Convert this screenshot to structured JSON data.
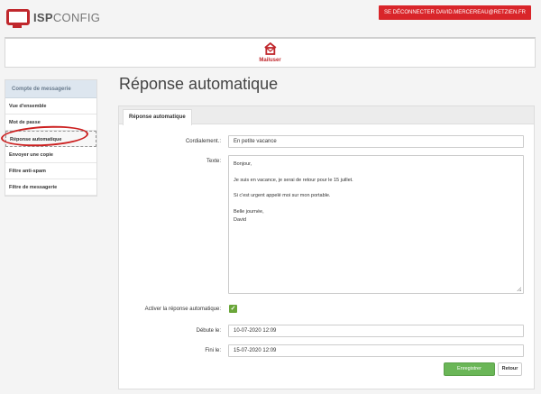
{
  "header": {
    "logo_main": "ISP",
    "logo_thin": "CONFIG",
    "logout_label": "SE DÉCONNECTER DAVID.MERCEREAU@RETZIEN.FR"
  },
  "module": {
    "label": "Mailuser",
    "icon": "mail-home-icon"
  },
  "sidebar": {
    "title": "Compte de messagerie",
    "items": [
      {
        "label": "Vue d'ensemble"
      },
      {
        "label": "Mot de passe"
      },
      {
        "label": "Réponse automatique"
      },
      {
        "label": "Envoyer une copie"
      },
      {
        "label": "Filtre anti-spam"
      },
      {
        "label": "Filtre de messagerie"
      }
    ]
  },
  "page": {
    "title": "Réponse automatique"
  },
  "tabs": [
    {
      "label": "Réponse automatique"
    }
  ],
  "form": {
    "subject": {
      "label": "Cordialement.:",
      "value": "En petite vacance"
    },
    "text": {
      "label": "Texte:",
      "lines": [
        "Bonjour,",
        "",
        "Je suis en vacance, je serai de retour pour le 15 juillet.",
        "",
        "Si c'est urgent appelé moi sur mon portable.",
        "",
        "Belle journée,",
        "David"
      ]
    },
    "activate": {
      "label": "Activer la réponse automatique:",
      "checked": true
    },
    "start": {
      "label": "Débute le:",
      "value": "10-07-2020 12:09"
    },
    "end": {
      "label": "Fini le:",
      "value": "15-07-2020 12:09"
    },
    "save_label": "Enregistrer",
    "back_label": "Retour"
  },
  "colors": {
    "brand_red": "#d9252a",
    "save_green": "#6ab657"
  }
}
